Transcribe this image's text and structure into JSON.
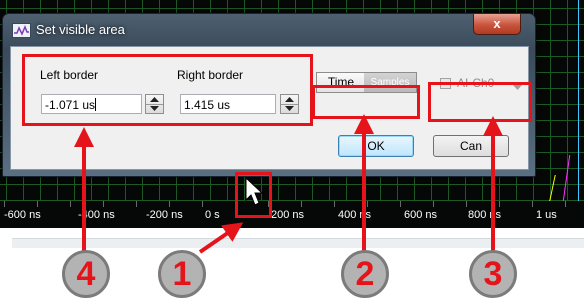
{
  "dialog": {
    "title": "Set visible area",
    "close_label": "x",
    "left_border": {
      "label": "Left border",
      "value": "-1.071 us"
    },
    "right_border": {
      "label": "Right border",
      "value": "1.415 us"
    },
    "units_toggle": {
      "selected": "Time",
      "other": "Samples"
    },
    "channel": {
      "label": "AI-Ch0"
    },
    "ok_label": "OK",
    "cancel_label": "Can"
  },
  "time_axis": {
    "ticks": [
      "-600 ns",
      "-400 ns",
      "-200 ns",
      "0 s",
      "200 ns",
      "400 ns",
      "600 ns",
      "800 ns",
      "1 us"
    ]
  },
  "callouts": [
    "1",
    "2",
    "3",
    "4"
  ],
  "colors": {
    "accent": "#e5141b",
    "grid": "#1d5a23",
    "scope_background": "#060808",
    "badge_fill": "#b3b3b3"
  },
  "icons": {
    "app": "waveform-icon",
    "cursor": "mouse-pointer-icon"
  }
}
